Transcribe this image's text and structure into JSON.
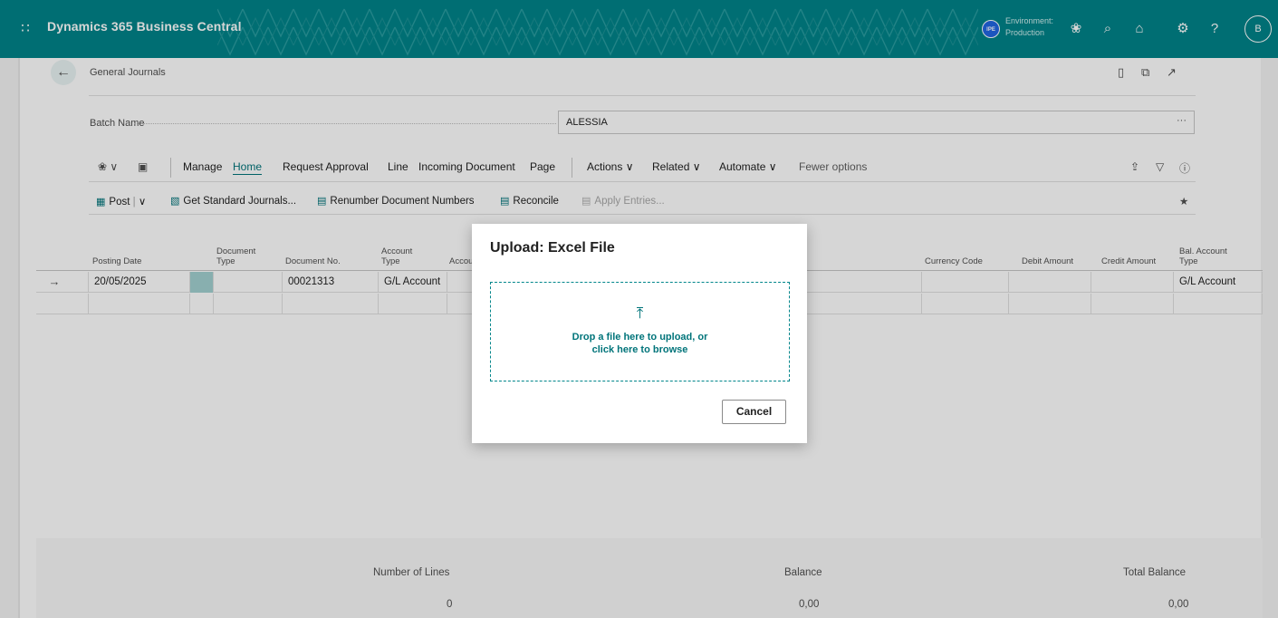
{
  "appbar": {
    "app_title": "Dynamics 365 Business Central",
    "env_badge": "IPE",
    "env_label": "Environment:",
    "env_value": "Production",
    "avatar_initial": "B",
    "color": "#008489"
  },
  "page": {
    "breadcrumb": "General Journals",
    "batch_label": "Batch Name",
    "batch_value": "ALESSIA",
    "batch_more": "···"
  },
  "actionbar": {
    "manage": "Manage",
    "home": "Home",
    "request_approval": "Request Approval",
    "line": "Line",
    "incoming_document": "Incoming Document",
    "page": "Page",
    "actions": "Actions",
    "related": "Related",
    "automate": "Automate",
    "fewer_options": "Fewer options"
  },
  "actionbar2": {
    "post": "Post",
    "get_standard_journals": "Get Standard Journals...",
    "renumber": "Renumber Document Numbers",
    "reconcile": "Reconcile",
    "apply_entries": "Apply Entries..."
  },
  "grid": {
    "headers": {
      "posting_date": "Posting Date",
      "document_type_1": "Document",
      "document_type_2": "Type",
      "document_no": "Document No.",
      "account_type_1": "Account",
      "account_type_2": "Type",
      "account_no": "Accou",
      "currency_code": "Currency Code",
      "debit_amount": "Debit Amount",
      "credit_amount": "Credit Amount",
      "bal_account_type_1": "Bal. Account",
      "bal_account_type_2": "Type"
    },
    "rows": [
      {
        "posting_date": "20/05/2025",
        "document_no": "00021313",
        "account_type": "G/L Account",
        "bal_account_type": "G/L Account"
      }
    ]
  },
  "footer": {
    "number_of_lines_label": "Number of Lines",
    "number_of_lines_value": "0",
    "balance_label": "Balance",
    "balance_value": "0,00",
    "total_balance_label": "Total Balance",
    "total_balance_value": "0,00"
  },
  "dialog": {
    "title": "Upload: Excel File",
    "drop_line1": "Drop a file here to upload, or",
    "drop_line2": "click here to browse",
    "cancel": "Cancel",
    "accent_color": "#00868b"
  },
  "icons": [
    "waffle-icon",
    "copilot-icon",
    "search-icon",
    "bell-icon",
    "gear-icon",
    "help-icon",
    "back-arrow-icon",
    "bookmark-icon",
    "open-new-icon",
    "collapse-icon",
    "share-icon",
    "filter-icon",
    "info-icon",
    "pin-icon",
    "upload-arrow-icon"
  ]
}
